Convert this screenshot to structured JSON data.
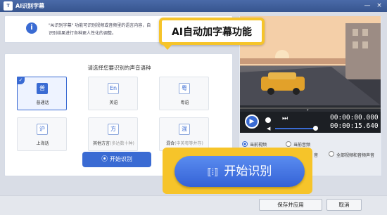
{
  "window": {
    "title": "AI识别字幕",
    "logo_text": "T",
    "minimize": "—",
    "close": "×"
  },
  "info": {
    "icon": "info-icon",
    "line1": "\"AI识别字幕\" 功能可识别视频或音频里的语言内容，自",
    "line2": "识别结果进行各种更人性化的调整。"
  },
  "languages": {
    "prompt": "请选择您要识别的声音语种",
    "items": [
      {
        "glyph": "普",
        "label": "普通话",
        "sub": "",
        "selected": true
      },
      {
        "glyph": "En",
        "label": "英语",
        "sub": "",
        "selected": false
      },
      {
        "glyph": "粤",
        "label": "粤语",
        "sub": "",
        "selected": false
      },
      {
        "glyph": "沪",
        "label": "上海话",
        "sub": "",
        "selected": false
      },
      {
        "glyph": "方",
        "label": "其他方言",
        "sub": "(多达数十种)",
        "selected": false
      },
      {
        "glyph": "混",
        "label": "混合",
        "sub": "(中英粤等并存)",
        "selected": false
      }
    ]
  },
  "start_small": {
    "label": "开始识别"
  },
  "player": {
    "time_current": "00:00:00.000",
    "time_total": "00:00:15.640"
  },
  "scope": {
    "options": [
      {
        "label": "当前视频",
        "selected": true
      },
      {
        "label": "当前音频",
        "selected": false
      },
      {
        "label": "音",
        "selected": false
      },
      {
        "label": "全部视频和音频声音",
        "selected": false
      }
    ]
  },
  "callouts": {
    "top": "AI自动加字幕功能",
    "bottom_button": "开始识别"
  },
  "footer": {
    "save_label": "保存并应用",
    "cancel_label": "取消"
  },
  "colors": {
    "accent": "#3a6bd3",
    "highlight": "#f6c42a",
    "titlebar": "#37558f"
  }
}
